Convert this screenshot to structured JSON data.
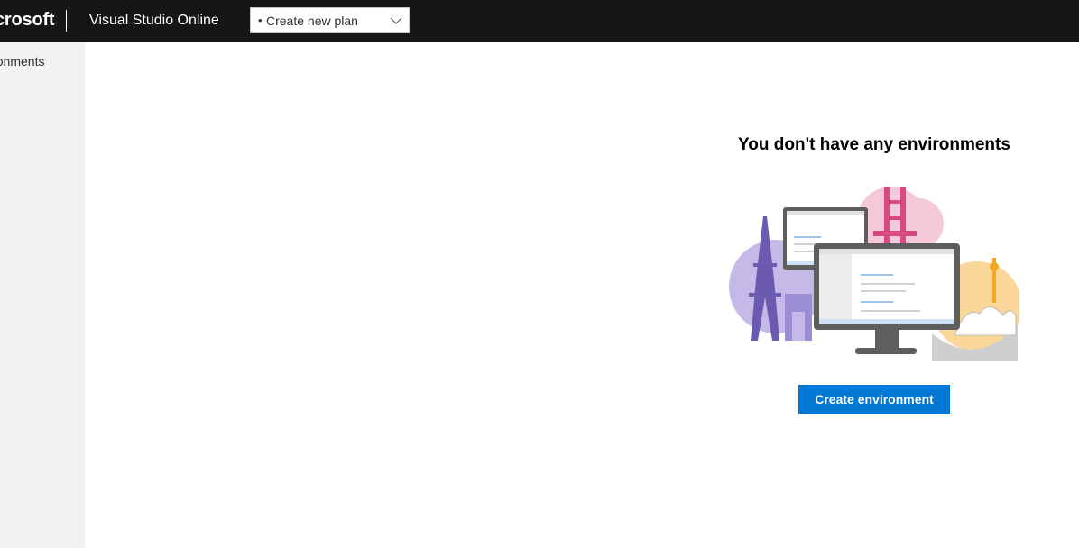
{
  "header": {
    "brand": "crosoft",
    "app_title": "Visual Studio Online",
    "plan_select": {
      "bullet": "•",
      "value": "Create new plan"
    }
  },
  "sidebar": {
    "items": [
      {
        "label": "ironments"
      }
    ]
  },
  "main": {
    "empty_title": "You don't have any environments",
    "illustration_icon": "environments-cities-illustration",
    "create_button": "Create environment"
  },
  "colors": {
    "topbar": "#161616",
    "accent": "#0078d4",
    "sidebar": "#f3f2f1"
  }
}
